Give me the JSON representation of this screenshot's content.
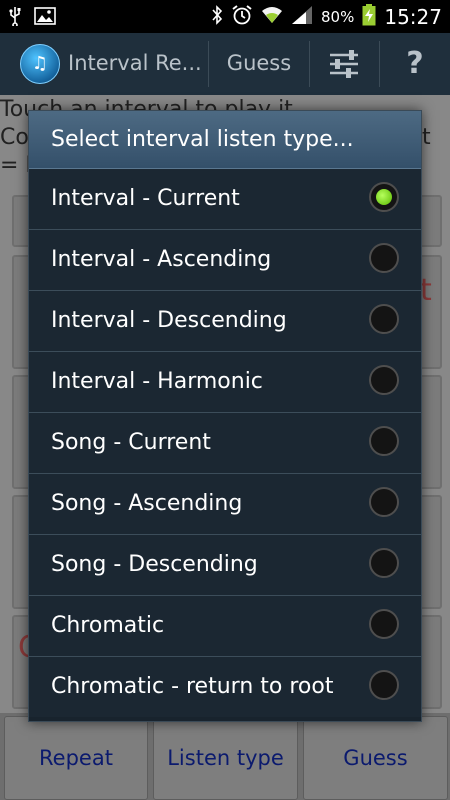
{
  "status_bar": {
    "battery_percent": "80%",
    "time": "15:27"
  },
  "action_bar": {
    "title": "Interval Re...",
    "guess_label": "Guess",
    "help_label": "?"
  },
  "background": {
    "line1": "Touch an interval to play it",
    "line2": "Co",
    "line2_end": "t",
    "line3": "= F",
    "red_partial_1": "t",
    "red_partial_2": "C"
  },
  "bottom_bar": {
    "repeat_label": "Repeat",
    "listen_type_label": "Listen type",
    "guess_label": "Guess"
  },
  "dialog": {
    "title": "Select interval listen type...",
    "options": [
      {
        "label": "Interval - Current",
        "checked": true
      },
      {
        "label": "Interval - Ascending",
        "checked": false
      },
      {
        "label": "Interval - Descending",
        "checked": false
      },
      {
        "label": "Interval - Harmonic",
        "checked": false
      },
      {
        "label": "Song - Current",
        "checked": false
      },
      {
        "label": "Song - Ascending",
        "checked": false
      },
      {
        "label": "Song - Descending",
        "checked": false
      },
      {
        "label": "Chromatic",
        "checked": false
      },
      {
        "label": "Chromatic - return to root",
        "checked": false
      }
    ]
  },
  "colors": {
    "radio_selected": "#7ed321",
    "dialog_bg": "#1b2732",
    "dialog_header": "#40607a"
  }
}
